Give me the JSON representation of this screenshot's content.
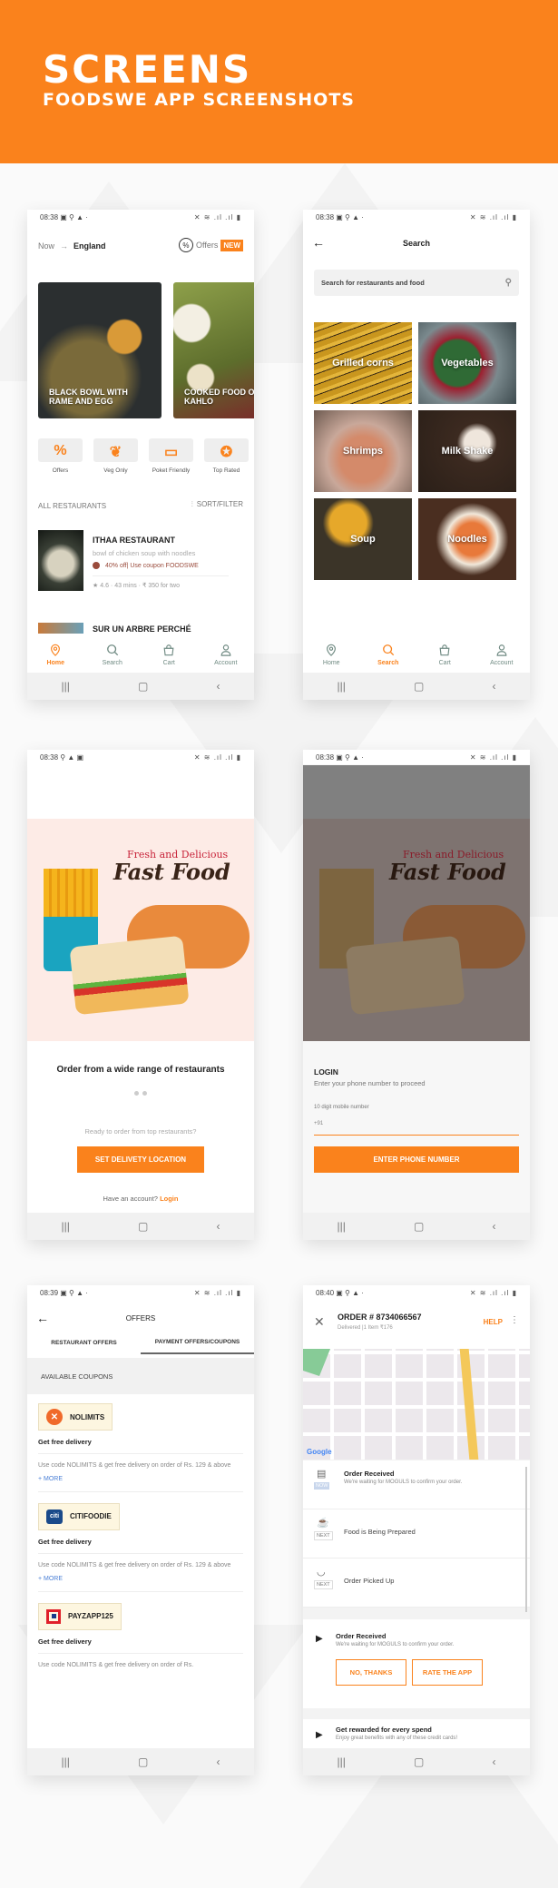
{
  "banner": {
    "title": "SCREENS",
    "subtitle": "FOODSWE APP SCREENSHOTS"
  },
  "colors": {
    "accent": "#fa821c",
    "banner": "#fa821c"
  },
  "status_icons": "✕ ≋ .ıl .ıl ▮",
  "nav": {
    "recent": "|||",
    "home": "▢",
    "back": "‹"
  },
  "tabs": [
    {
      "label": "Home",
      "icon": "location-pin-icon"
    },
    {
      "label": "Search",
      "icon": "search-icon"
    },
    {
      "label": "Cart",
      "icon": "bag-icon"
    },
    {
      "label": "Account",
      "icon": "user-icon"
    }
  ],
  "home": {
    "time": "08:38",
    "location_prefix": "Now",
    "location": "England",
    "offers_label": "Offers",
    "new_badge": "NEW",
    "featured": [
      {
        "title": "BLACK BOWL WITH RAME AND EGG"
      },
      {
        "title": "COOKED FOOD OF KAHLO"
      }
    ],
    "filters": [
      {
        "label": "Offers",
        "icon": "percent-badge-icon"
      },
      {
        "label": "Veg Only",
        "icon": "vegetables-icon"
      },
      {
        "label": "Poket Friendly",
        "icon": "wallet-icon"
      },
      {
        "label": "Top Rated",
        "icon": "award-icon"
      }
    ],
    "all_restaurants": "ALL RESTAURANTS",
    "sort_filter": "SORT/FILTER",
    "restaurants": [
      {
        "name": "ITHAA RESTAURANT",
        "desc": "bowl of chicken soup with noodles",
        "offer": "40% off| Use coupon FOODSWE",
        "rating": "4.6",
        "time": "43 mins",
        "price": "₹ 350 for two"
      },
      {
        "name": "SUR UN ARBRE PERCHÉ"
      }
    ]
  },
  "search": {
    "time": "08:38",
    "title": "Search",
    "placeholder": "Search for restaurants and food",
    "categories": [
      "Grilled corns",
      "Vegetables",
      "Shrimps",
      "Milk Shake",
      "Soup",
      "Noodles"
    ]
  },
  "onboard": {
    "time": "08:38",
    "art_tagline": "Fresh and Delicious",
    "art_title": "Fast Food",
    "heading": "Order from a wide range of restaurants",
    "prompt": "Ready to order from top restaurants?",
    "cta": "SET DELIVETY LOCATION",
    "have_account": "Have an account?",
    "login": "Login"
  },
  "login": {
    "time": "08:38",
    "art_tagline": "Fresh and Delicious",
    "art_title": "Fast Food",
    "title": "LOGIN",
    "subtitle": "Enter your phone number to proceed",
    "field_label": "10 digit mobile number",
    "field_value": "+91",
    "cta": "ENTER PHONE NUMBER"
  },
  "offers": {
    "time": "08:39",
    "title": "OFFERS",
    "tabs": [
      "RESTAURANT OFFERS",
      "PAYMENT OFFERS/COUPONS"
    ],
    "active_tab": 1,
    "section": "AVAILABLE COUPONS",
    "coupons": [
      {
        "code": "NOLIMITS",
        "title": "Get free delivery",
        "desc": "Use code NOLIMITS & get free delivery on order of Rs. 129 & above",
        "more": "+ MORE"
      },
      {
        "code": "CITIFOODIE",
        "title": "Get free delivery",
        "desc": "Use code NOLIMITS & get free delivery on order of Rs. 129 & above",
        "more": "+ MORE"
      },
      {
        "code": "PAYZAPP125",
        "title": "Get free delivery",
        "desc": "Use code NOLIMITS & get free delivery on order of Rs."
      }
    ]
  },
  "order": {
    "time": "08:40",
    "title": "ORDER # 8734066567",
    "subtitle": "Delivered |1 Item ₹176",
    "help": "HELP",
    "map_brand": "Google",
    "steps": [
      {
        "badge": "NOW",
        "title": "Order Received",
        "desc": "We're waiting for MOGULS to confirm your order."
      },
      {
        "badge": "NEXT",
        "title": "Food is Being Prepared"
      },
      {
        "badge": "NEXT",
        "title": "Order Picked Up"
      }
    ],
    "card": {
      "title": "Order Received",
      "desc": "We're waiting for MOGULS to confirm your order.",
      "no": "NO, THANKS",
      "rate": "RATE THE APP"
    },
    "reward": {
      "title": "Get rewarded for every spend",
      "desc": "Enjoy great benefits with any of these credit cards!"
    }
  }
}
